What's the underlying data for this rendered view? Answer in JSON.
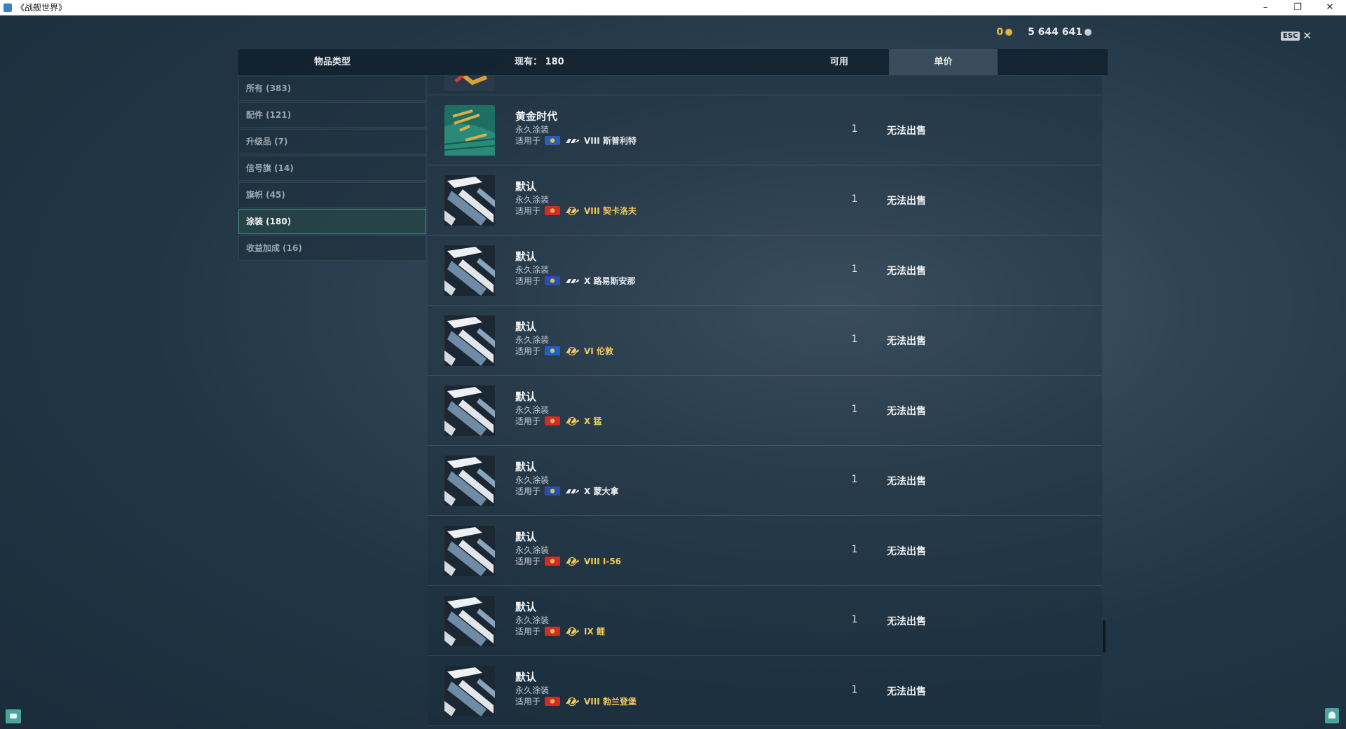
{
  "window": {
    "title": "《战舰世界》",
    "controls": [
      "–",
      "❐",
      "✕"
    ]
  },
  "currency": {
    "gold": "0",
    "credits": "5 644 641"
  },
  "esc": {
    "key": "ESC",
    "close": "✕"
  },
  "header": {
    "category": "物品类型",
    "owned": "现有：  180",
    "available": "可用",
    "unit_price": "单价"
  },
  "sidebar": {
    "items": [
      {
        "label": "所有 (383)"
      },
      {
        "label": "配件 (121)"
      },
      {
        "label": "升级品 (7)"
      },
      {
        "label": "信号旗 (14)"
      },
      {
        "label": "旗帜 (45)"
      },
      {
        "label": "涂装 (180)"
      },
      {
        "label": "收益加成 (16)"
      }
    ],
    "active_index": 5
  },
  "applies_label": "适用于",
  "rows": [
    {
      "name": "黄金时代",
      "sub": "永久涂装",
      "flag": "flag-pan-america-icon",
      "flag_color": "#2c5fb0",
      "ship_icon": "destroyer-icon",
      "ship": "VIII 斯普利特",
      "premium": false,
      "available": "1",
      "price": "无法出售",
      "thumb": "golden-age"
    },
    {
      "name": "默认",
      "sub": "永久涂装",
      "flag": "flag-soviet-icon",
      "flag_color": "#d42a2a",
      "ship_icon": "premium-cruiser-icon",
      "ship": "VIII 契卡洛夫",
      "premium": true,
      "available": "1",
      "price": "无法出售",
      "thumb": "default"
    },
    {
      "name": "默认",
      "sub": "永久涂装",
      "flag": "flag-france-icon",
      "flag_color": "#2a4fb0",
      "ship_icon": "battleship-icon",
      "ship": "X 路易斯安那",
      "premium": false,
      "available": "1",
      "price": "无法出售",
      "thumb": "default"
    },
    {
      "name": "默认",
      "sub": "永久涂装",
      "flag": "flag-commonwealth-icon",
      "flag_color": "#1f5fc9",
      "ship_icon": "premium-battleship-icon",
      "ship": "VI 伦敦",
      "premium": true,
      "available": "1",
      "price": "无法出售",
      "thumb": "default"
    },
    {
      "name": "默认",
      "sub": "永久涂装",
      "flag": "flag-red-icon",
      "flag_color": "#d42a2a",
      "ship_icon": "premium-battleship-icon",
      "ship": "X 猛",
      "premium": true,
      "available": "1",
      "price": "无法出售",
      "thumb": "default"
    },
    {
      "name": "默认",
      "sub": "永久涂装",
      "flag": "flag-france-icon",
      "flag_color": "#2a4fb0",
      "ship_icon": "battleship-icon",
      "ship": "X 蒙大拿",
      "premium": false,
      "available": "1",
      "price": "无法出售",
      "thumb": "default"
    },
    {
      "name": "默认",
      "sub": "永久涂装",
      "flag": "flag-red-icon",
      "flag_color": "#d42a2a",
      "ship_icon": "premium-cruiser-icon",
      "ship": "VIII I-56",
      "premium": true,
      "available": "1",
      "price": "无法出售",
      "thumb": "default"
    },
    {
      "name": "默认",
      "sub": "永久涂装",
      "flag": "flag-red-icon",
      "flag_color": "#d42a2a",
      "ship_icon": "premium-battleship-icon",
      "ship": "IX 鲤",
      "premium": true,
      "available": "1",
      "price": "无法出售",
      "thumb": "default"
    },
    {
      "name": "默认",
      "sub": "永久涂装",
      "flag": "flag-red-icon",
      "flag_color": "#d42a2a",
      "ship_icon": "premium-battleship-icon",
      "ship": "VIII 勃兰登堡",
      "premium": true,
      "available": "1",
      "price": "无法出售",
      "thumb": "default"
    }
  ]
}
